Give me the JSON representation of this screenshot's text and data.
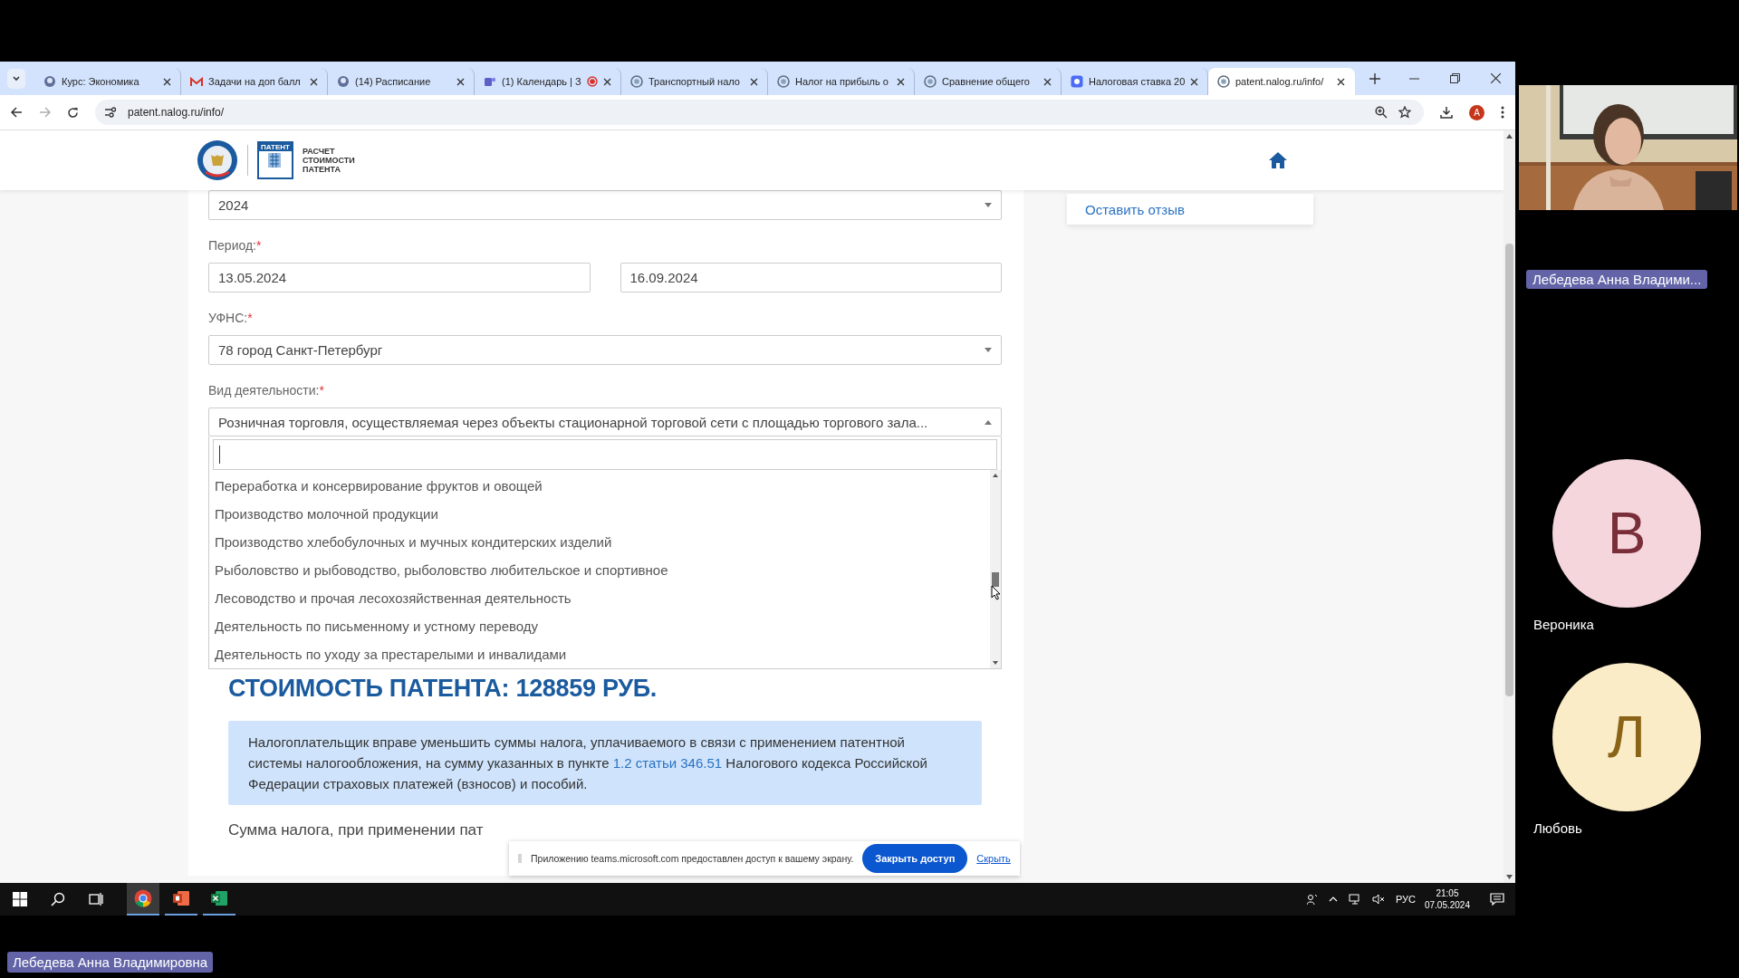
{
  "browser": {
    "tabs": [
      {
        "title": "Курс: Экономика",
        "kind": "moodle",
        "selected": false,
        "recording": false
      },
      {
        "title": "Задачи на доп балл",
        "kind": "mail",
        "selected": false,
        "recording": false
      },
      {
        "title": "(14) Расписание",
        "kind": "moodle",
        "selected": false,
        "recording": false
      },
      {
        "title": "(1) Календарь | З",
        "kind": "teams",
        "selected": false,
        "recording": true
      },
      {
        "title": "Транспортный нало",
        "kind": "nalog",
        "selected": false,
        "recording": false
      },
      {
        "title": "Налог на прибыль о",
        "kind": "nalog",
        "selected": false,
        "recording": false
      },
      {
        "title": "Сравнение общего",
        "kind": "nalog",
        "selected": false,
        "recording": false
      },
      {
        "title": "Налоговая ставка 20",
        "kind": "app",
        "selected": false,
        "recording": false
      },
      {
        "title": "patent.nalog.ru/info/",
        "kind": "nalog",
        "selected": true,
        "recording": false
      }
    ],
    "forward_disabled": true,
    "url": "patent.nalog.ru/info/",
    "profile_initial": "A"
  },
  "site": {
    "logo_badge": "ПАТЕНТ",
    "logo_title": [
      "РАСЧЕТ",
      "СТОИМОСТИ",
      "ПАТЕНТА"
    ],
    "feedback_link": "Оставить отзыв",
    "year": "2024",
    "period": {
      "label": "Период:",
      "required_mark": "*",
      "from": "13.05.2024",
      "to": "16.09.2024"
    },
    "ufns": {
      "label": "УФНС:",
      "required_mark": "*",
      "value": "78 город Санкт-Петербург"
    },
    "activity": {
      "label": "Вид деятельности:",
      "required_mark": "*",
      "value": "Розничная торговля, осуществляемая через объекты стационарной торговой сети с площадью торгового зала...",
      "expanded": true,
      "options": [
        "Переработка и консервирование фруктов и овощей",
        "Производство молочной продукции",
        "Производство хлебобулочных и мучных кондитерских изделий",
        "Рыболовство и рыбоводство, рыболовство любительское и спортивное",
        "Лесоводство и прочая лесохозяйственная деятельность",
        "Деятельность по письменному и устному переводу",
        "Деятельность по уходу за престарелыми и инвалидами"
      ]
    },
    "cost": "СТОИМОСТЬ ПАТЕНТА: 128859 РУБ.",
    "info": {
      "before": "Налогоплательщик вправе уменьшить суммы налога, уплачиваемого в связи с применением патентной системы налогообложения, на сумму указанных в пункте ",
      "link": "1.2 статьи 346.51",
      "after": " Налогового кодекса Российской Федерации страховых платежей (взносов) и пособий."
    },
    "tax_sum_text": "Сумма налога, при применении пат"
  },
  "share_bar": {
    "message": "Приложению teams.microsoft.com предоставлен доступ к вашему экрану.",
    "stop_button": "Закрыть доступ",
    "hide_link": "Скрыть"
  },
  "taskbar": {
    "apps": [
      {
        "kind": "chrome",
        "selected": true
      },
      {
        "kind": "powerpoint",
        "selected": false
      },
      {
        "kind": "excel",
        "selected": false
      }
    ],
    "language": "РУС",
    "time": "21:05",
    "date": "07.05.2024"
  },
  "participants": [
    {
      "kind": "video",
      "name": "Лебедева Анна Владими..."
    },
    {
      "kind": "avatar",
      "initial": "В",
      "name": "Вероника",
      "color": "#f4d6dc"
    },
    {
      "kind": "avatar",
      "initial": "Л",
      "name": "Любовь",
      "color": "#fbecc8"
    }
  ],
  "presenter": "Лебедева Анна Владимировна"
}
